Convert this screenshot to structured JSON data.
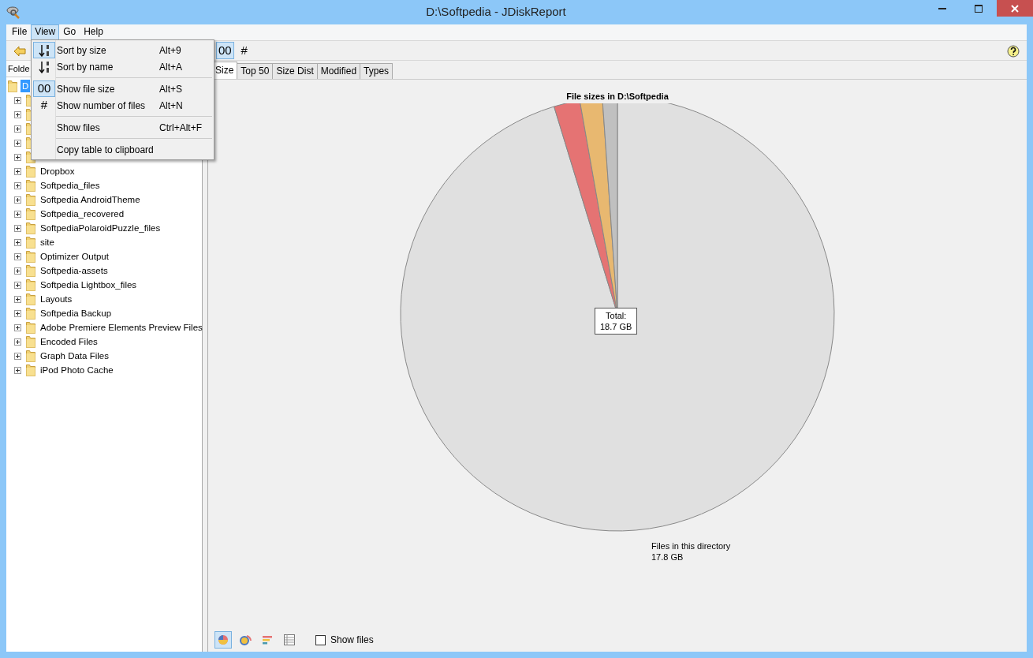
{
  "window": {
    "title": "D:\\Softpedia - JDiskReport"
  },
  "menu_bar": [
    {
      "label": "File",
      "selected": false
    },
    {
      "label": "View",
      "selected": true
    },
    {
      "label": "Go",
      "selected": false
    },
    {
      "label": "Help",
      "selected": false
    }
  ],
  "view_menu": [
    {
      "kind": "sort",
      "label": "Sort by size",
      "shortcut": "Alt+9",
      "checked": true
    },
    {
      "kind": "sort",
      "label": "Sort by name",
      "shortcut": "Alt+A",
      "checked": false
    },
    {
      "kind": "separator"
    },
    {
      "kind": "item",
      "glyph": "00",
      "label": "Show file size",
      "shortcut": "Alt+S",
      "checked": true
    },
    {
      "kind": "item",
      "glyph": "#",
      "label": "Show number of files",
      "shortcut": "Alt+N",
      "checked": false
    },
    {
      "kind": "separator"
    },
    {
      "kind": "item",
      "label": "Show files",
      "shortcut": "Ctrl+Alt+F",
      "checked": false
    },
    {
      "kind": "separator"
    },
    {
      "kind": "item",
      "label": "Copy table to clipboard",
      "checked": false
    }
  ],
  "toolbar": [
    {
      "label": "00",
      "selected": true
    },
    {
      "label": "#",
      "selected": false
    }
  ],
  "folder_panel": {
    "header": "Folde",
    "tree": [
      {
        "label": "D",
        "selected": true,
        "children": [
          {
            "expanded": false
          },
          {
            "expanded": false
          },
          {
            "expanded": false
          },
          {
            "expanded": false
          },
          {
            "expanded": false
          },
          {
            "label": "Dropbox",
            "expanded": false
          },
          {
            "label": "Softpedia_files",
            "expanded": false
          },
          {
            "label": "Softpedia AndroidTheme",
            "expanded": false
          },
          {
            "label": "Softpedia_recovered",
            "expanded": false
          },
          {
            "label": "SoftpediaPolaroidPuzzle_files",
            "expanded": false
          },
          {
            "label": "site",
            "expanded": false
          },
          {
            "label": "Optimizer Output",
            "expanded": false
          },
          {
            "label": "Softpedia-assets",
            "expanded": false
          },
          {
            "label": "Softpedia Lightbox_files",
            "expanded": false
          },
          {
            "label": "Layouts",
            "expanded": false
          },
          {
            "label": "Softpedia Backup",
            "expanded": false
          },
          {
            "label": "Adobe Premiere Elements Preview Files",
            "expanded": false
          },
          {
            "label": "Encoded Files",
            "expanded": false
          },
          {
            "label": "Graph Data Files",
            "expanded": false
          },
          {
            "label": "iPod Photo Cache",
            "expanded": false
          }
        ]
      }
    ]
  },
  "tabs": [
    {
      "label": "Size",
      "selected": true
    },
    {
      "label": "Top 50",
      "selected": false
    },
    {
      "label": "Size Dist",
      "selected": false
    },
    {
      "label": "Modified",
      "selected": false
    },
    {
      "label": "Types",
      "selected": false
    }
  ],
  "chart": {
    "title": "File sizes in D:\\Softpedia",
    "total_label": "Total:",
    "total_value": "18.7 GB",
    "slice_label": "Files in this directory",
    "slice_value": "17.8 GB"
  },
  "view_buttons": [
    {
      "kind": "pie",
      "selected": true
    },
    {
      "kind": "ring",
      "selected": false
    },
    {
      "kind": "bars",
      "selected": false
    },
    {
      "kind": "table",
      "selected": false
    }
  ],
  "show_files": {
    "label": "Show files",
    "checked": false
  }
}
